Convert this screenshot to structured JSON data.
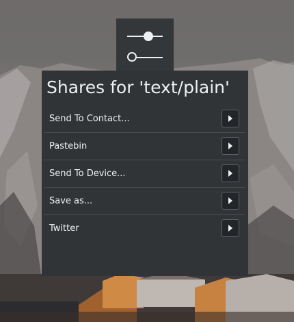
{
  "popup": {
    "title": "Shares for 'text/plain'",
    "items": [
      {
        "label": "Send To Contact..."
      },
      {
        "label": "Pastebin"
      },
      {
        "label": "Send To Device..."
      },
      {
        "label": "Save as..."
      },
      {
        "label": "Twitter"
      }
    ]
  },
  "icons": {
    "top_tile": "configure-sliders-icon",
    "item_action": "chevron-right-icon"
  },
  "colors": {
    "panel_background": "#313437",
    "text": "#eff0f1",
    "button_background": "#232629",
    "separator": "#484c50"
  }
}
